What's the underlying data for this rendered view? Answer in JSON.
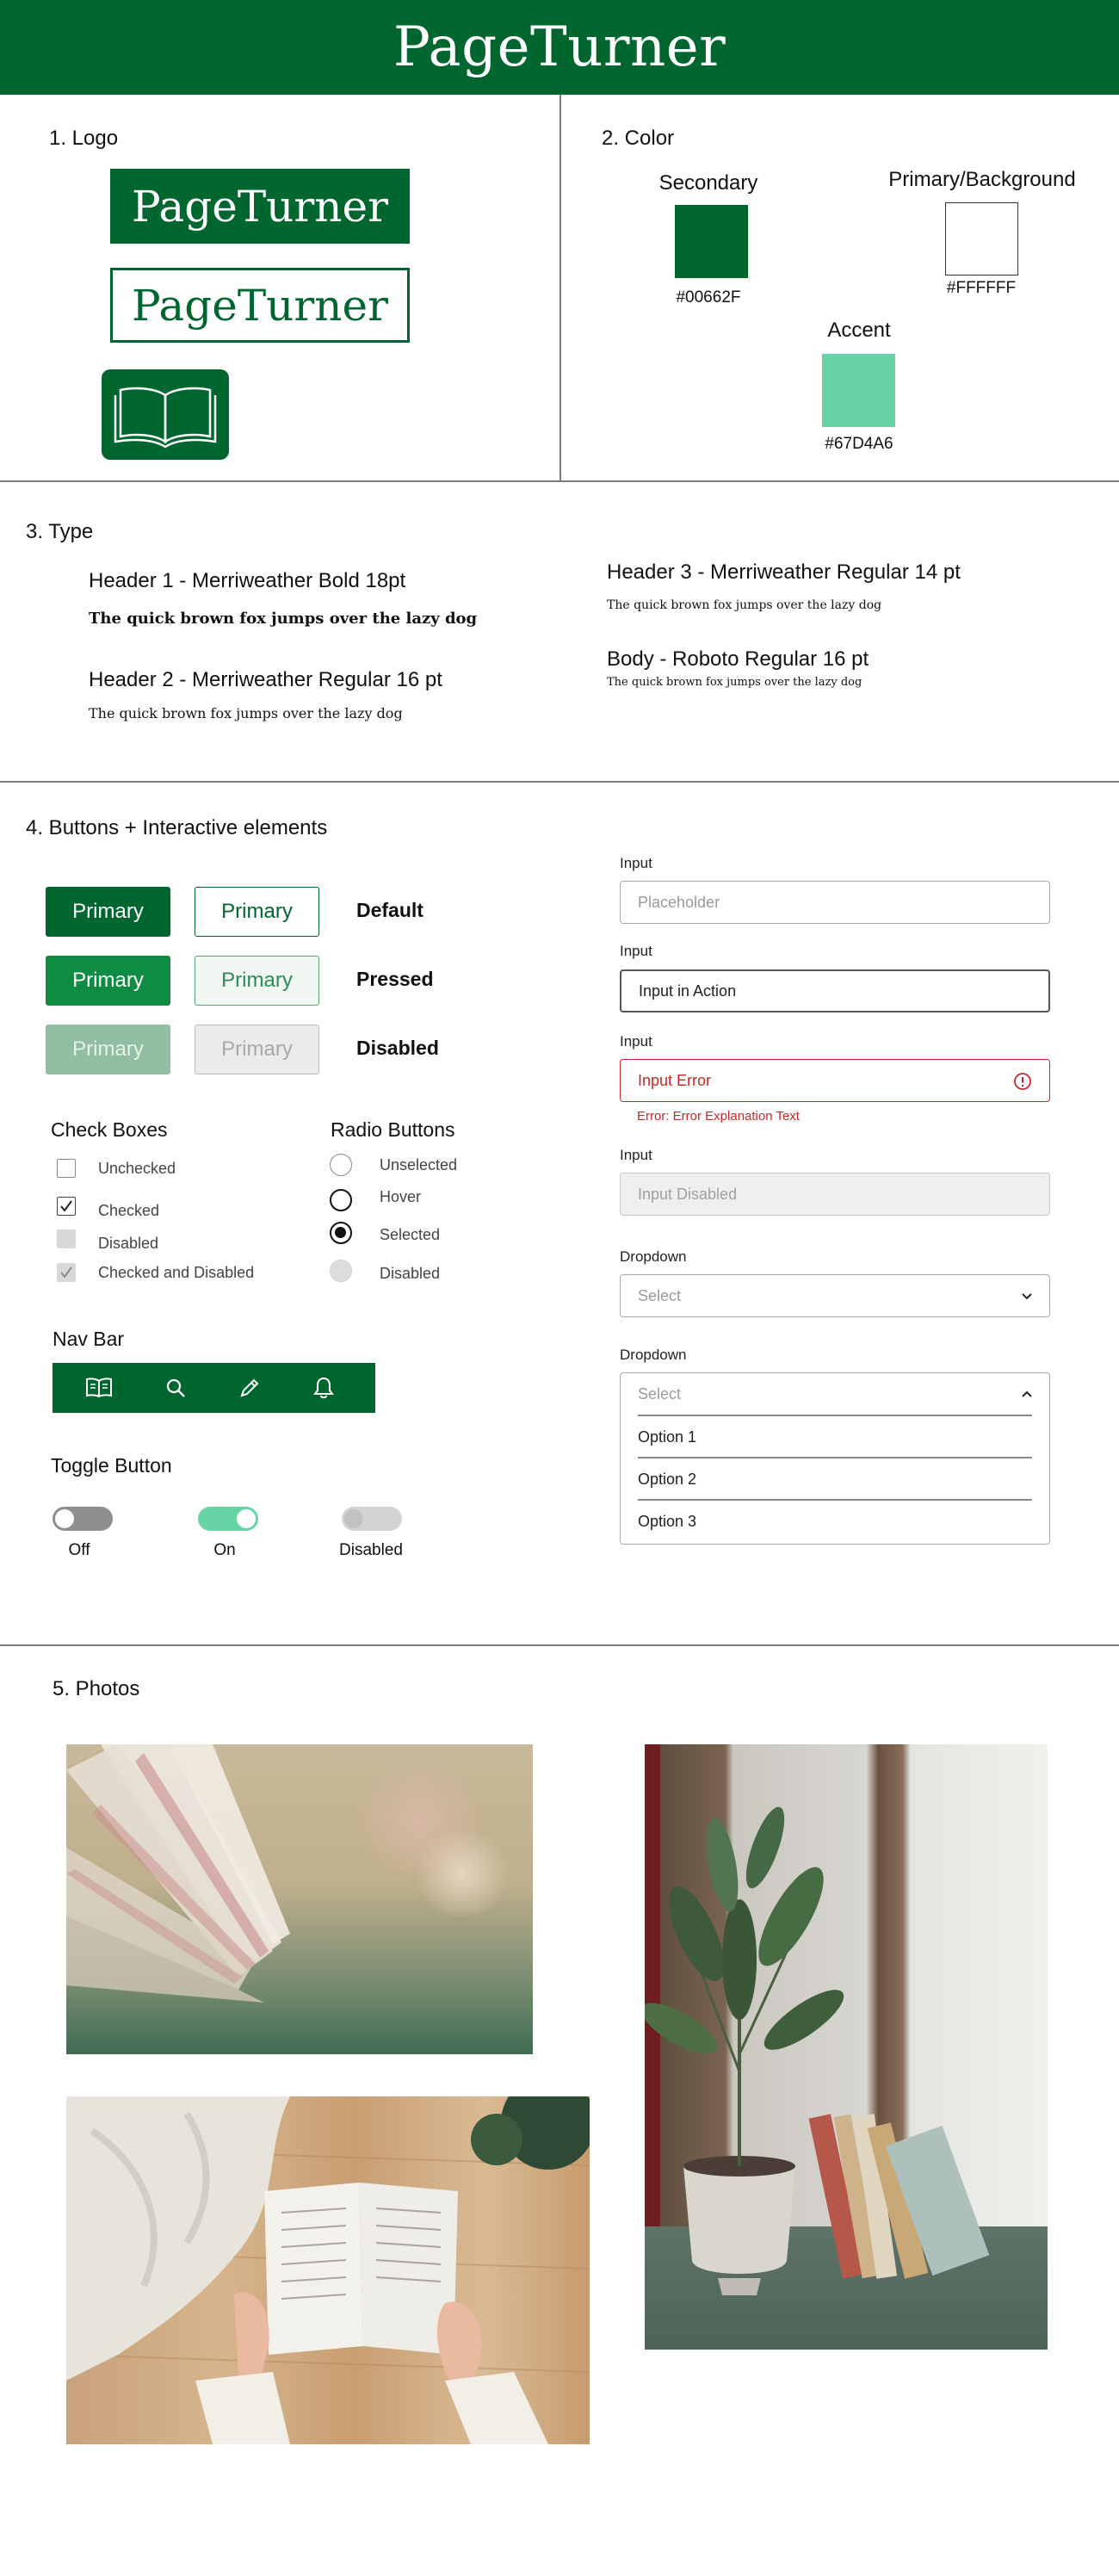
{
  "app": {
    "title": "PageTurner"
  },
  "sections": {
    "logo": "1. Logo",
    "color": "2. Color",
    "type": "3. Type",
    "buttons": "4. Buttons + Interactive elements",
    "photos": "5. Photos"
  },
  "logo": {
    "wordmark": "PageTurner",
    "icon": "open-book-icon"
  },
  "colors": {
    "secondary": {
      "label": "Secondary",
      "hex": "#00662F"
    },
    "primary": {
      "label": "Primary/Background",
      "hex": "#FFFFFF"
    },
    "accent": {
      "label": "Accent",
      "hex": "#67D4A6"
    }
  },
  "type": {
    "h1": {
      "label": "Header 1 - Merriweather Bold 18pt",
      "sample": "The quick brown fox jumps over the lazy dog"
    },
    "h2": {
      "label": "Header 2 - Merriweather Regular 16 pt",
      "sample": "The quick brown fox jumps over the lazy dog"
    },
    "h3": {
      "label": "Header 3 - Merriweather Regular 14 pt",
      "sample": "The quick brown fox jumps over the lazy dog"
    },
    "body": {
      "label": "Body - Roboto Regular 16 pt",
      "sample": "The quick brown fox jumps over the lazy dog"
    }
  },
  "buttons": {
    "label": "Primary",
    "states": {
      "default": "Default",
      "pressed": "Pressed",
      "disabled": "Disabled"
    }
  },
  "checkboxes": {
    "title": "Check Boxes",
    "items": [
      "Unchecked",
      "Checked",
      "Disabled",
      "Checked and Disabled"
    ]
  },
  "radios": {
    "title": "Radio Buttons",
    "items": [
      "Unselected",
      "Hover",
      "Selected",
      "Disabled"
    ]
  },
  "navbar": {
    "title": "Nav Bar",
    "icons": [
      "book-icon",
      "search-icon",
      "pencil-icon",
      "bell-icon"
    ]
  },
  "toggles": {
    "title": "Toggle Button",
    "items": [
      "Off",
      "On",
      "Disabled"
    ]
  },
  "inputs": {
    "label": "Input",
    "placeholder": "Placeholder",
    "in_action": "Input in Action",
    "error_value": "Input Error",
    "error_text": "Error: Error Explanation Text",
    "disabled_value": "Input Disabled",
    "dropdown_label": "Dropdown",
    "select_placeholder": "Select",
    "options": [
      "Option 1",
      "Option 2",
      "Option 3"
    ]
  },
  "theme": {
    "green": "#00662F",
    "accent": "#67D4A6",
    "error": "#C62828"
  }
}
